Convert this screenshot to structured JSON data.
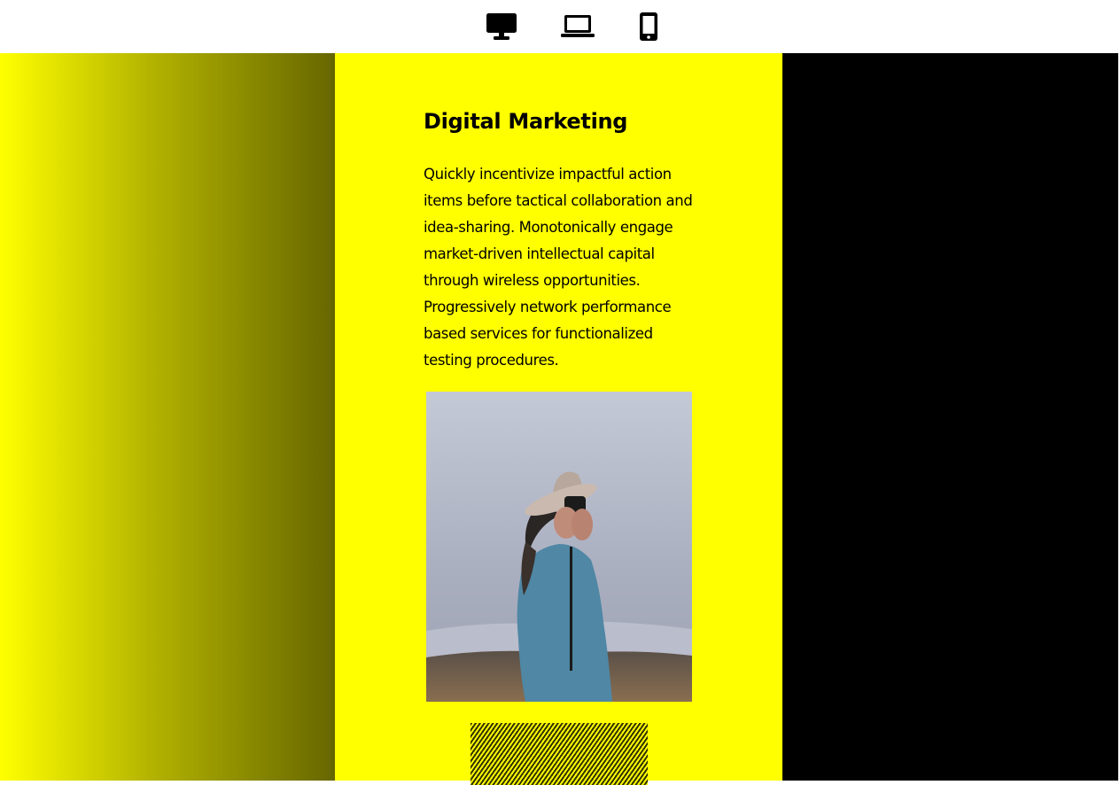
{
  "toolbar": {
    "devices": [
      {
        "name": "desktop",
        "icon": "desktop-icon"
      },
      {
        "name": "laptop",
        "icon": "laptop-icon"
      },
      {
        "name": "mobile",
        "icon": "mobile-phone-icon"
      }
    ]
  },
  "colors": {
    "accent": "#ffff00",
    "dark": "#000000",
    "gradient_end": "#666600"
  },
  "card": {
    "title": "Digital Marketing",
    "body": "Quickly incentivize impactful action items before tactical collaboration and idea-sharing. Monotonically engage market-driven intellectual capital through wireless opportunities. Progressively network performance based services for functionalized testing procedures."
  }
}
